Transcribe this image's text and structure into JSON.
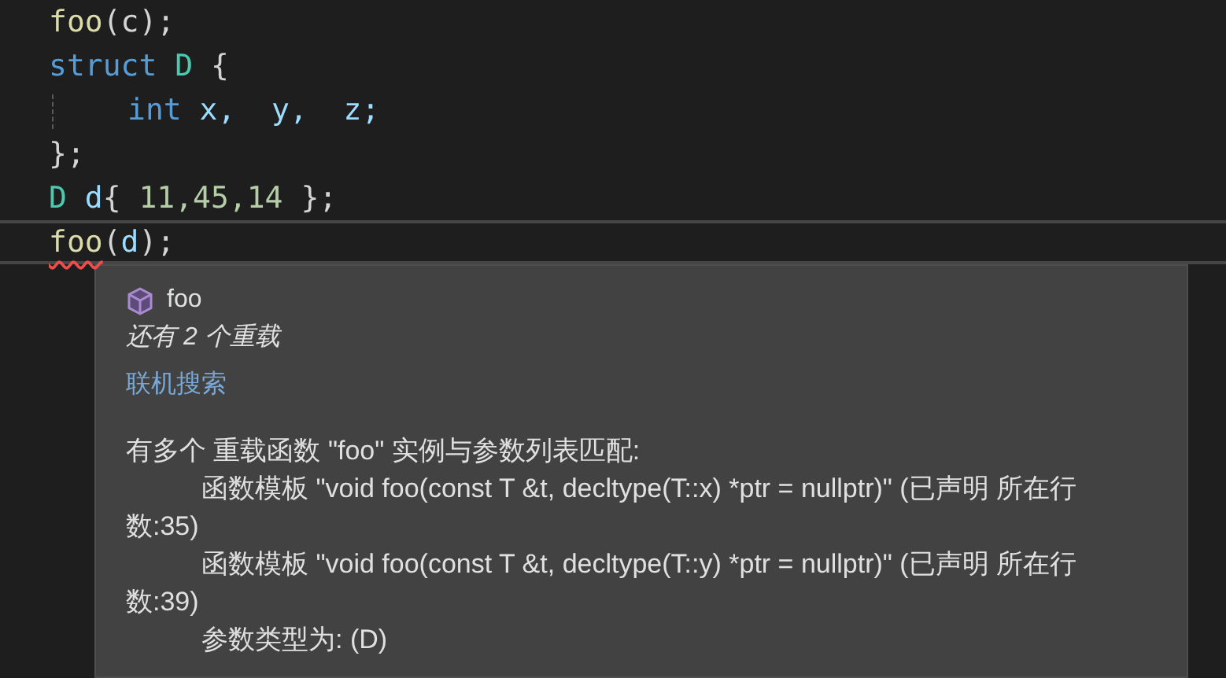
{
  "code_lines": [
    {
      "current": false,
      "squiggle": false,
      "indent_guide": false,
      "tokens": [
        {
          "kind": "function",
          "text": "foo"
        },
        {
          "kind": "punct",
          "text": "(c);"
        }
      ]
    },
    {
      "current": false,
      "squiggle": false,
      "indent_guide": false,
      "tokens": [
        {
          "kind": "keyword",
          "text": "struct"
        },
        {
          "kind": "type",
          "text": " D"
        },
        {
          "kind": "punct",
          "text": " {"
        }
      ]
    },
    {
      "current": false,
      "squiggle": false,
      "indent_guide": true,
      "tokens": [
        {
          "kind": "keyword",
          "text": "int"
        },
        {
          "kind": "variable",
          "text": " x,"
        },
        {
          "kind": "variable",
          "text": "  y,"
        },
        {
          "kind": "variable",
          "text": "  z;"
        }
      ]
    },
    {
      "current": false,
      "squiggle": false,
      "indent_guide": false,
      "tokens": [
        {
          "kind": "punct",
          "text": "};"
        }
      ]
    },
    {
      "current": false,
      "squiggle": false,
      "indent_guide": false,
      "tokens": [
        {
          "kind": "type",
          "text": "D"
        },
        {
          "kind": "variable",
          "text": " d"
        },
        {
          "kind": "punct",
          "text": "{ "
        },
        {
          "kind": "number",
          "text": "11,45,14"
        },
        {
          "kind": "punct",
          "text": " };"
        }
      ]
    },
    {
      "current": true,
      "squiggle": true,
      "indent_guide": false,
      "tokens": [
        {
          "kind": "function",
          "text": "foo"
        },
        {
          "kind": "punct",
          "text": "("
        },
        {
          "kind": "variable",
          "text": "d"
        },
        {
          "kind": "punct",
          "text": ");"
        }
      ]
    }
  ],
  "tooltip": {
    "symbol": "foo",
    "overloads": "还有 2 个重载",
    "search_link": "联机搜索",
    "message": [
      {
        "indent": false,
        "text": "有多个 重载函数 \"foo\" 实例与参数列表匹配:"
      },
      {
        "indent": true,
        "text": "函数模板 \"void foo(const T &t, decltype(T::x) *ptr = nullptr)\" (已声明 所在行数:35)"
      },
      {
        "indent": true,
        "text": "函数模板 \"void foo(const T &t, decltype(T::y) *ptr = nullptr)\" (已声明 所在行数:39)"
      },
      {
        "indent": true,
        "text": "参数类型为: (D)"
      }
    ]
  }
}
